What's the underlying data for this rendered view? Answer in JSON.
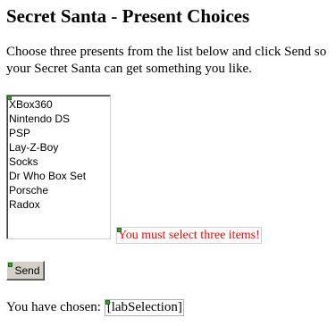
{
  "page": {
    "title": "Secret Santa - Present Choices",
    "instructions": "Choose three presents from the list below and click Send so your Secret Santa can get something you like."
  },
  "presents": {
    "options": [
      "XBox360",
      "Nintendo DS",
      "PSP",
      "Lay-Z-Boy",
      "Socks",
      "Dr Who Box Set",
      "Porsche",
      "Radox"
    ]
  },
  "validation": {
    "message": "You must select three items!",
    "color": "#ff0000"
  },
  "form": {
    "send_label": "Send"
  },
  "result": {
    "chosen_prefix": "You have chosen:",
    "selection_text": "[labSelection]"
  },
  "colors": {
    "design_marker": "#34a334",
    "button_face": "#d4d0c8"
  }
}
